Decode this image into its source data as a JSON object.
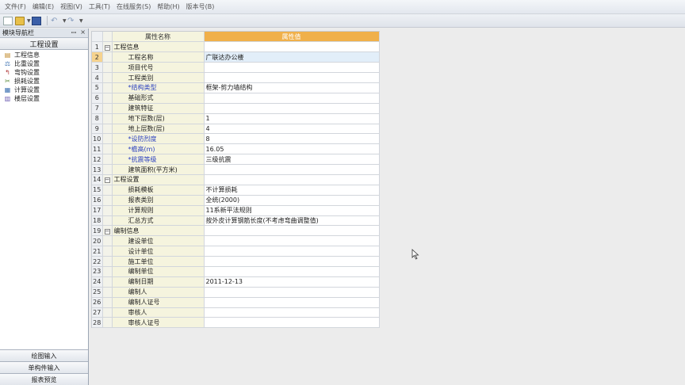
{
  "menu": [
    "文件(F)",
    "编辑(E)",
    "视图(V)",
    "工具(T)",
    "在线服务(S)",
    "帮助(H)",
    "版本号(B)"
  ],
  "sidebar": {
    "title": "模块导航栏",
    "pin": "ꟷ",
    "close": "×",
    "section": "工程设置",
    "items": [
      {
        "label": "工程信息",
        "icon": "info-icon"
      },
      {
        "label": "比重设置",
        "icon": "weight-icon"
      },
      {
        "label": "弯钩设置",
        "icon": "hook-icon"
      },
      {
        "label": "损耗设置",
        "icon": "loss-icon"
      },
      {
        "label": "计算设置",
        "icon": "calc-icon"
      },
      {
        "label": "楼层设置",
        "icon": "floor-icon"
      }
    ],
    "bottom": [
      "绘图输入",
      "单构件输入",
      "报表预览"
    ]
  },
  "grid": {
    "header_name": "属性名称",
    "header_value": "属性值",
    "rows": [
      {
        "n": "1",
        "name": "工程信息",
        "value": "",
        "group": true
      },
      {
        "n": "2",
        "name": "工程名称",
        "value": "广联达办公楼",
        "sel": true
      },
      {
        "n": "3",
        "name": "项目代号",
        "value": ""
      },
      {
        "n": "4",
        "name": "工程类别",
        "value": ""
      },
      {
        "n": "5",
        "name": "*结构类型",
        "value": "框架-剪力墙结构",
        "blue": true
      },
      {
        "n": "6",
        "name": "基础形式",
        "value": ""
      },
      {
        "n": "7",
        "name": "建筑特征",
        "value": ""
      },
      {
        "n": "8",
        "name": "地下层数(层)",
        "value": "1"
      },
      {
        "n": "9",
        "name": "地上层数(层)",
        "value": "4"
      },
      {
        "n": "10",
        "name": "*设防烈度",
        "value": "8",
        "blue": true
      },
      {
        "n": "11",
        "name": "*檐高(m)",
        "value": "16.05",
        "blue": true
      },
      {
        "n": "12",
        "name": "*抗震等级",
        "value": "三级抗震",
        "blue": true
      },
      {
        "n": "13",
        "name": "建筑面积(平方米)",
        "value": ""
      },
      {
        "n": "14",
        "name": "工程设置",
        "value": "",
        "group": true
      },
      {
        "n": "15",
        "name": "损耗模板",
        "value": "不计算损耗"
      },
      {
        "n": "16",
        "name": "报表类别",
        "value": "全统(2000)"
      },
      {
        "n": "17",
        "name": "计算规则",
        "value": "11系新平法规则"
      },
      {
        "n": "18",
        "name": "汇总方式",
        "value": "按外皮计算钢筋长度(不考虑弯曲调整值)"
      },
      {
        "n": "19",
        "name": "编制信息",
        "value": "",
        "group": true
      },
      {
        "n": "20",
        "name": "建设单位",
        "value": ""
      },
      {
        "n": "21",
        "name": "设计单位",
        "value": ""
      },
      {
        "n": "22",
        "name": "施工单位",
        "value": ""
      },
      {
        "n": "23",
        "name": "编制单位",
        "value": ""
      },
      {
        "n": "24",
        "name": "编制日期",
        "value": "2011-12-13"
      },
      {
        "n": "25",
        "name": "编制人",
        "value": ""
      },
      {
        "n": "26",
        "name": "编制人证号",
        "value": ""
      },
      {
        "n": "27",
        "name": "审核人",
        "value": ""
      },
      {
        "n": "28",
        "name": "审核人证号",
        "value": ""
      }
    ]
  },
  "colors": {
    "header_value_bg": "#f0b04a",
    "name_col_bg": "#f5f4de",
    "required_text": "#2a3fbf"
  }
}
